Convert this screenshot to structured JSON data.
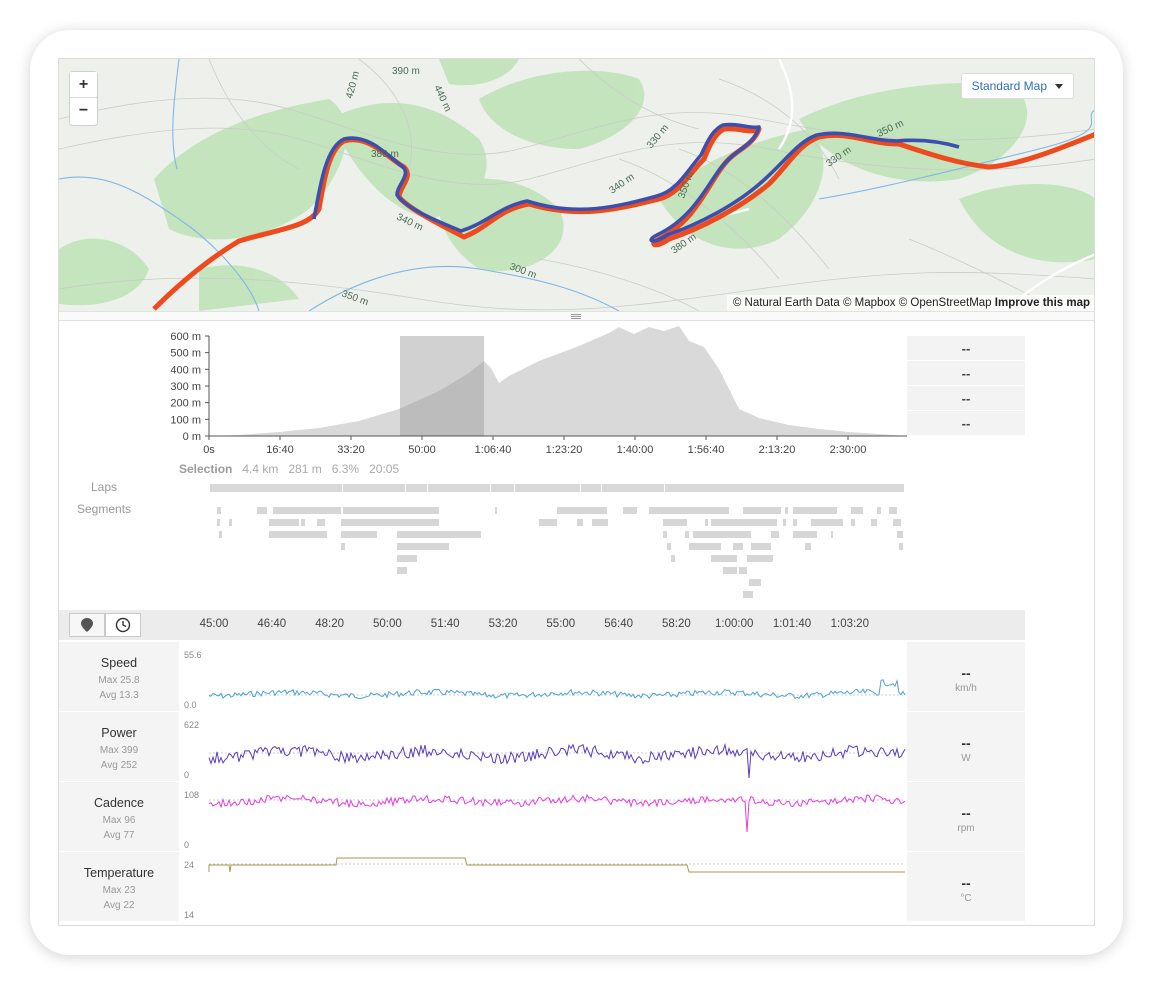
{
  "map": {
    "zoom_in": "+",
    "zoom_out": "−",
    "map_type": "Standard Map",
    "attribution": "© Natural Earth Data © Mapbox © OpenStreetMap",
    "improve_link": "Improve this map",
    "contour_labels": [
      "390 m",
      "420 m",
      "440 m",
      "380 m",
      "340 m",
      "330 m",
      "340 m",
      "350 m",
      "330 m",
      "380 m",
      "300 m",
      "350 m",
      "330 m",
      "350 m"
    ]
  },
  "elevation": {
    "y_ticks": [
      "600 m",
      "500 m",
      "400 m",
      "300 m",
      "200 m",
      "100 m",
      "0 m"
    ],
    "x_ticks": [
      "0s",
      "16:40",
      "33:20",
      "50:00",
      "1:06:40",
      "1:23:20",
      "1:40:00",
      "1:56:40",
      "2:13:20",
      "2:30:00"
    ],
    "side_values": [
      "--",
      "--",
      "--",
      "--"
    ],
    "selection_label": "Selection",
    "selection_distance": "4.4 km",
    "selection_elevation": "281 m",
    "selection_grade": "6.3%",
    "selection_time": "20:05"
  },
  "rows": {
    "laps_label": "Laps",
    "segments_label": "Segments"
  },
  "streams_toolbar": {
    "x_ticks": [
      "45:00",
      "46:40",
      "48:20",
      "50:00",
      "51:40",
      "53:20",
      "55:00",
      "56:40",
      "58:20",
      "1:00:00",
      "1:01:40",
      "1:03:20"
    ]
  },
  "streams": [
    {
      "name": "Speed",
      "max": "Max 25.8",
      "avg": "Avg 13.3",
      "ymax": "55.6",
      "ymin": "0.0",
      "value": "--",
      "unit": "km/h",
      "color": "#4ba3d8"
    },
    {
      "name": "Power",
      "max": "Max 399",
      "avg": "Avg 252",
      "ymax": "622",
      "ymin": "0",
      "value": "--",
      "unit": "W",
      "color": "#5b3bbf"
    },
    {
      "name": "Cadence",
      "max": "Max 96",
      "avg": "Avg 77",
      "ymax": "108",
      "ymin": "0",
      "value": "--",
      "unit": "rpm",
      "color": "#e33ee0"
    },
    {
      "name": "Temperature",
      "max": "Max 23",
      "avg": "Avg 22",
      "ymax": "24",
      "ymin": "14",
      "value": "--",
      "unit": "°C",
      "color": "#a8994c"
    }
  ]
}
